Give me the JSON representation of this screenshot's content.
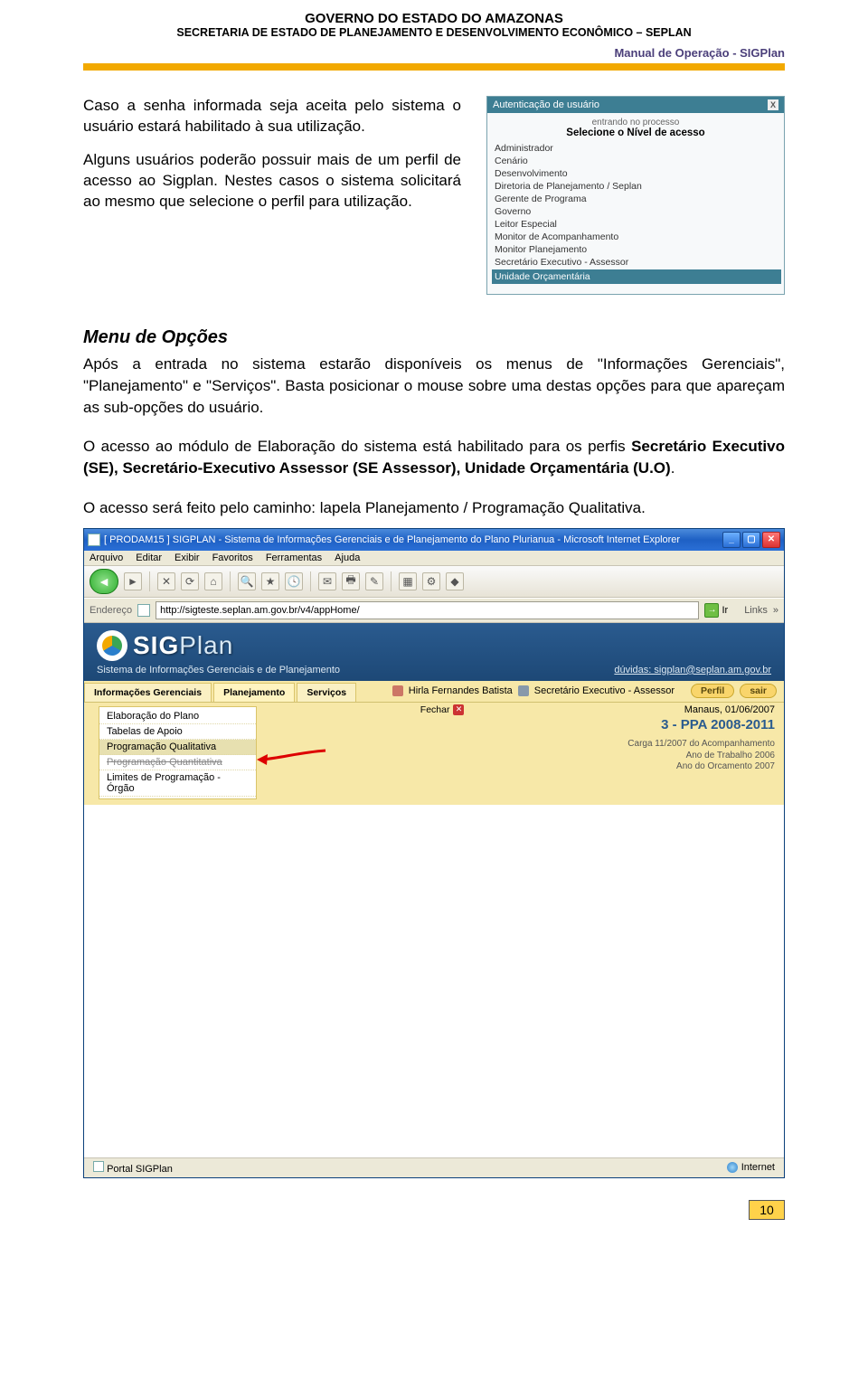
{
  "header": {
    "line1": "GOVERNO DO ESTADO DO AMAZONAS",
    "line2": "SECRETARIA DE ESTADO DE PLANEJAMENTO E DESENVOLVIMENTO ECONÔMICO – SEPLAN",
    "manual": "Manual de Operação - SIGPlan"
  },
  "intro": {
    "p1": "Caso a senha informada seja aceita pelo sistema o usuário estará habilitado à sua utilização.",
    "p2": "Alguns usuários poderão possuir mais de um perfil de acesso ao Sigplan. Nestes casos o sistema solicitará ao mesmo que selecione o perfil para utilização."
  },
  "auth": {
    "title": "Autenticação de usuário",
    "sub_small": "entrando no processo",
    "sub_bold": "Selecione o Nível de acesso",
    "items": [
      "Administrador",
      "Cenário",
      "Desenvolvimento",
      "Diretoria de Planejamento / Seplan",
      "Gerente de Programa",
      "Governo",
      "Leitor Especial",
      "Monitor de Acompanhamento",
      "Monitor Planejamento",
      "Secretário Executivo - Assessor"
    ],
    "highlight": "Unidade Orçamentária"
  },
  "menu_section": {
    "heading": "Menu de Opções",
    "p1": "Após a entrada no sistema estarão disponíveis os menus de \"Informações Gerenciais\", \"Planejamento\" e \"Serviços\". Basta posicionar o mouse sobre uma destas opções para que apareçam as sub-opções do usuário.",
    "p2_a": "O acesso ao módulo de Elaboração do sistema está habilitado para os perfis ",
    "p2_b": "Secretário Executivo (SE), Secretário-Executivo Assessor (SE Assessor), Unidade Orçamentária (U.O)",
    "p2_c": ".",
    "p3": "O acesso será feito pelo caminho: lapela Planejamento / Programação Qualitativa."
  },
  "ie": {
    "title": "[ PRODAM15 ]   SIGPLAN - Sistema de Informações Gerenciais e de Planejamento do Plano Plurianua - Microsoft Internet Explorer",
    "menu": [
      "Arquivo",
      "Editar",
      "Exibir",
      "Favoritos",
      "Ferramentas",
      "Ajuda"
    ],
    "addr_label": "Endereço",
    "addr_value": "http://sigteste.seplan.am.gov.br/v4/appHome/",
    "go": "Ir",
    "links": "Links",
    "status_left": "Portal SIGPlan",
    "status_right": "Internet"
  },
  "app": {
    "logo": "SIG",
    "logo2": "Plan",
    "subtitle": "Sistema de Informações Gerenciais e de Planejamento",
    "duvidas": "dúvidas: sigplan@seplan.am.gov.br",
    "tabs": [
      "Informações Gerenciais",
      "Planejamento",
      "Serviços"
    ],
    "user": "Hirla Fernandes Batista",
    "role": "Secretário Executivo - Assessor",
    "perfil": "Perfil",
    "sair": "sair",
    "fechar": "Fechar",
    "loc_date": "Manaus, 01/06/2007",
    "ppa": "3 - PPA 2008-2011",
    "carga": "Carga 11/2007 do Acompanhamento",
    "ano_trab": "Ano de Trabalho 2006",
    "ano_orc": "Ano do Orcamento 2007",
    "side": {
      "i0": "Elaboração do Plano",
      "i1": "Tabelas de Apoio",
      "i2": "Programação Qualitativa",
      "i3": "Programação Quantitativa",
      "i4": "Limites de Programação - Órgão"
    }
  },
  "pagenum": "10"
}
